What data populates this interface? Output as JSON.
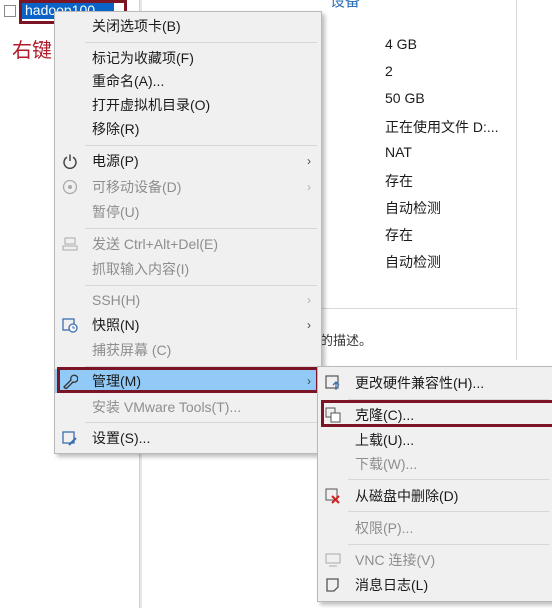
{
  "vm_name": "hadoop100",
  "annotation": "右键",
  "section_hint": "设备",
  "specs": [
    "4 GB",
    "2",
    "50 GB",
    "正在使用文件 D:...",
    "NAT",
    "存在",
    "自动检测",
    "存在",
    "自动检测"
  ],
  "description": "的描述。",
  "main_menu": {
    "close_tab": "关闭选项卡(B)",
    "favorite": "标记为收藏项(F)",
    "rename": "重命名(A)...",
    "open_dir": "打开虚拟机目录(O)",
    "remove": "移除(R)",
    "power": "电源(P)",
    "removable": "可移动设备(D)",
    "pause": "暂停(U)",
    "send_cad": "发送 Ctrl+Alt+Del(E)",
    "grab_input": "抓取输入内容(I)",
    "ssh": "SSH(H)",
    "snapshot": "快照(N)",
    "capture_screen": "捕获屏幕 (C)",
    "manage": "管理(M)",
    "install_tools": "安装 VMware Tools(T)...",
    "settings": "设置(S)..."
  },
  "sub_menu": {
    "hw_compat": "更改硬件兼容性(H)...",
    "clone": "克隆(C)...",
    "upload": "上载(U)...",
    "download": "下载(W)...",
    "delete_disk": "从磁盘中删除(D)",
    "permissions": "权限(P)...",
    "vnc": "VNC 连接(V)",
    "msg_log": "消息日志(L)"
  },
  "colors": {
    "highlight_box": "#7b1425",
    "menu_hover": "#91c9f7",
    "selection": "#0a64c8",
    "annotation": "#b01c2a"
  }
}
